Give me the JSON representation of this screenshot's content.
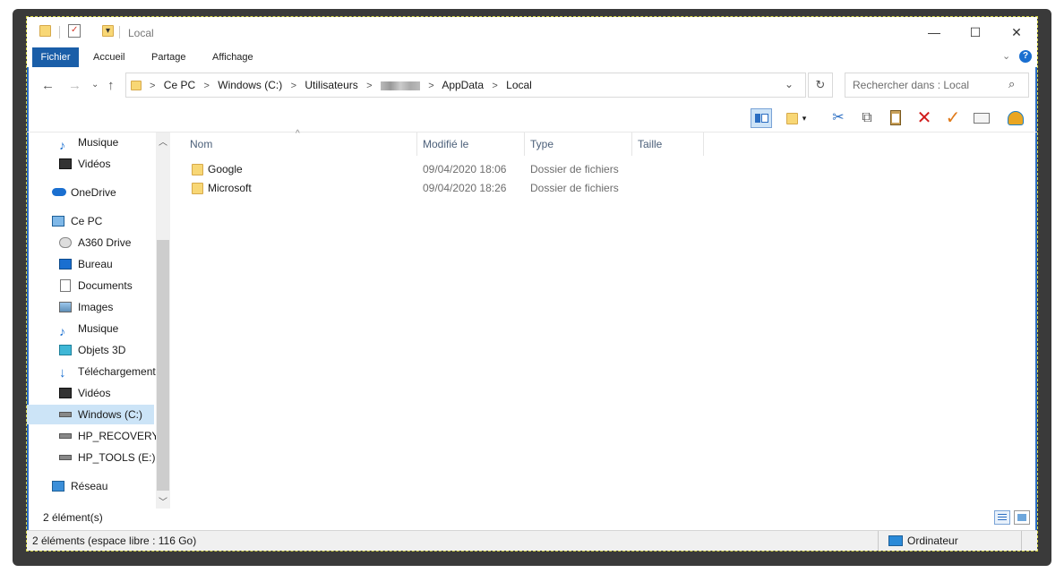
{
  "window": {
    "title": "Local",
    "controls": {
      "minimize": "—",
      "maximize": "☐",
      "close": "✕"
    }
  },
  "ribbon": {
    "tabs": [
      "Fichier",
      "Accueil",
      "Partage",
      "Affichage"
    ]
  },
  "address": {
    "crumbs": [
      "Ce PC",
      "Windows (C:)",
      "Utilisateurs",
      "AppData",
      "Local"
    ],
    "search_placeholder": "Rechercher dans : Local"
  },
  "nav": {
    "items": [
      {
        "label": "Musique",
        "icon": "music-icon"
      },
      {
        "label": "Vidéos",
        "icon": "videos-icon"
      },
      {
        "label": "OneDrive",
        "icon": "onedrive-icon"
      },
      {
        "label": "Ce PC",
        "icon": "computer-icon"
      },
      {
        "label": "A360 Drive",
        "icon": "a360-drive-icon"
      },
      {
        "label": "Bureau",
        "icon": "desktop-icon"
      },
      {
        "label": "Documents",
        "icon": "documents-icon"
      },
      {
        "label": "Images",
        "icon": "images-icon"
      },
      {
        "label": "Musique",
        "icon": "music-icon"
      },
      {
        "label": "Objets 3D",
        "icon": "3d-objects-icon"
      },
      {
        "label": "Téléchargements",
        "icon": "downloads-icon"
      },
      {
        "label": "Vidéos",
        "icon": "videos-icon"
      },
      {
        "label": "Windows (C:)",
        "icon": "drive-icon"
      },
      {
        "label": "HP_RECOVERY (",
        "icon": "drive-icon"
      },
      {
        "label": "HP_TOOLS (E:)",
        "icon": "drive-icon"
      },
      {
        "label": "Réseau",
        "icon": "network-icon"
      }
    ]
  },
  "columns": {
    "name": "Nom",
    "modified": "Modifié le",
    "type": "Type",
    "size": "Taille"
  },
  "files": [
    {
      "name": "Google",
      "modified": "09/04/2020 18:06",
      "type": "Dossier de fichiers",
      "size": ""
    },
    {
      "name": "Microsoft",
      "modified": "09/04/2020 18:26",
      "type": "Dossier de fichiers",
      "size": ""
    }
  ],
  "status": {
    "count": "2 élément(s)",
    "bottom_left": "2 éléments (espace libre : 116 Go)",
    "bottom_right": "Ordinateur"
  },
  "colors": {
    "accent": "#1a5ea8",
    "selection": "#cce4f7",
    "folder": "#f8d775"
  }
}
